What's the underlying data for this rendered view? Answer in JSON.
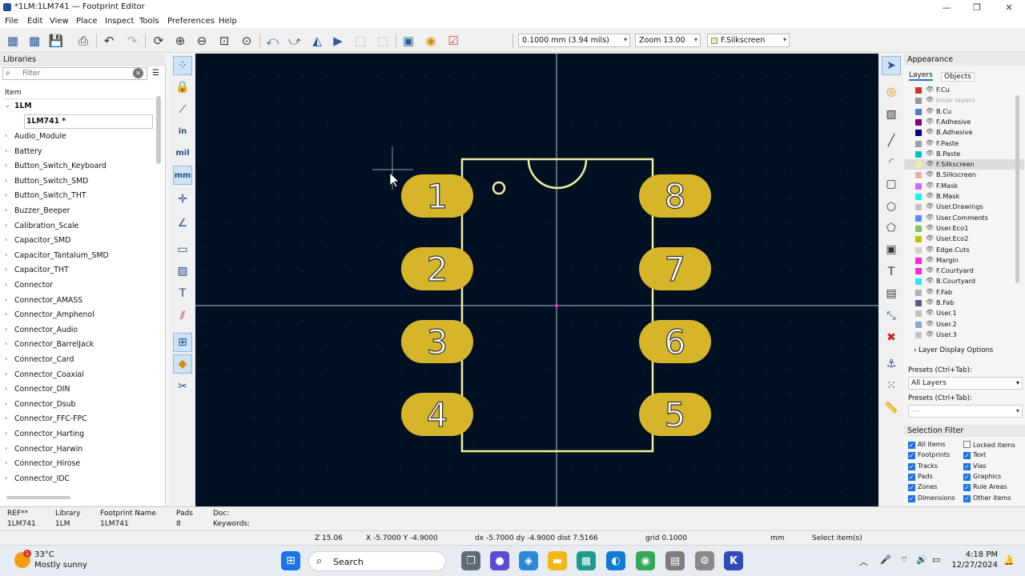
{
  "window": {
    "title": "*1LM:1LM741 — Footprint Editor",
    "minimize": "—",
    "maximize": "❐",
    "close": "✕"
  },
  "menu": [
    "File",
    "Edit",
    "View",
    "Place",
    "Inspect",
    "Tools",
    "Preferences",
    "Help"
  ],
  "toolbar": {
    "grid": "0.1000 mm (3.94 mils)",
    "zoom": "Zoom 13.00",
    "layer": "F.Silkscreen",
    "layer_color": "#f2eda1"
  },
  "libraries": {
    "header": "Libraries",
    "filter_placeholder": "Filter",
    "column_header": "Item",
    "open_library": "1LM",
    "selected_footprint": "1LM741 *",
    "items": [
      "Audio_Module",
      "Battery",
      "Button_Switch_Keyboard",
      "Button_Switch_SMD",
      "Button_Switch_THT",
      "Buzzer_Beeper",
      "Calibration_Scale",
      "Capacitor_SMD",
      "Capacitor_Tantalum_SMD",
      "Capacitor_THT",
      "Connector",
      "Connector_AMASS",
      "Connector_Amphenol",
      "Connector_Audio",
      "Connector_BarrelJack",
      "Connector_Card",
      "Connector_Coaxial",
      "Connector_DIN",
      "Connector_Dsub",
      "Connector_FFC-FPC",
      "Connector_Harting",
      "Connector_Harwin",
      "Connector_Hirose",
      "Connector_IDC"
    ]
  },
  "left_toolbar": {
    "units_in": "in",
    "units_mil": "mil",
    "units_mm": "mm"
  },
  "pads": {
    "left": [
      "1",
      "2",
      "3",
      "4"
    ],
    "right": [
      "8",
      "7",
      "6",
      "5"
    ],
    "pad_color": "#d7b52a",
    "silk_color": "#f2eda1"
  },
  "appearance": {
    "header": "Appearance",
    "tabs": [
      "Layers",
      "Objects"
    ],
    "layers": [
      {
        "name": "F.Cu",
        "color": "#c83434"
      },
      {
        "name": "Inner layers",
        "color": "#999999",
        "dim": true
      },
      {
        "name": "B.Cu",
        "color": "#4d7fc4"
      },
      {
        "name": "F.Adhesive",
        "color": "#84007c"
      },
      {
        "name": "B.Adhesive",
        "color": "#00008a"
      },
      {
        "name": "F.Paste",
        "color": "#a0a0a0"
      },
      {
        "name": "B.Paste",
        "color": "#00c2c2"
      },
      {
        "name": "F.Silkscreen",
        "color": "#f2eda1",
        "active": true
      },
      {
        "name": "B.Silkscreen",
        "color": "#e8b2a7"
      },
      {
        "name": "F.Mask",
        "color": "#d864ff"
      },
      {
        "name": "B.Mask",
        "color": "#02ffee"
      },
      {
        "name": "User.Drawings",
        "color": "#c2c2c2"
      },
      {
        "name": "User.Comments",
        "color": "#598bff"
      },
      {
        "name": "User.Eco1",
        "color": "#85c452"
      },
      {
        "name": "User.Eco2",
        "color": "#c2c200"
      },
      {
        "name": "Edge.Cuts",
        "color": "#d0d2cd"
      },
      {
        "name": "Margin",
        "color": "#ff26e2"
      },
      {
        "name": "F.Courtyard",
        "color": "#ff26e2"
      },
      {
        "name": "B.Courtyard",
        "color": "#26e9ff"
      },
      {
        "name": "F.Fab",
        "color": "#afafaf"
      },
      {
        "name": "B.Fab",
        "color": "#585d84"
      },
      {
        "name": "User.1",
        "color": "#c2c2c2"
      },
      {
        "name": "User.2",
        "color": "#89a9d2"
      },
      {
        "name": "User.3",
        "color": "#c2c2c2"
      }
    ],
    "layer_display_options": "Layer Display Options",
    "presets_label": "Presets (Ctrl+Tab):",
    "presets_value": "All Layers",
    "presets_label2": "Presets (Ctrl+Tab):",
    "presets_value2": "---"
  },
  "selection_filter": {
    "header": "Selection Filter",
    "items": [
      {
        "label": "All items",
        "checked": true
      },
      {
        "label": "Locked items",
        "checked": false
      },
      {
        "label": "Footprints",
        "checked": true
      },
      {
        "label": "Text",
        "checked": true
      },
      {
        "label": "Tracks",
        "checked": true
      },
      {
        "label": "Vias",
        "checked": true
      },
      {
        "label": "Pads",
        "checked": true
      },
      {
        "label": "Graphics",
        "checked": true
      },
      {
        "label": "Zones",
        "checked": true
      },
      {
        "label": "Rule Areas",
        "checked": true
      },
      {
        "label": "Dimensions",
        "checked": true
      },
      {
        "label": "Other items",
        "checked": true
      }
    ]
  },
  "info": {
    "ref_label": "REF**",
    "ref_value": "1LM741",
    "lib_label": "Library",
    "lib_value": "1LM",
    "fp_label": "Footprint Name",
    "fp_value": "1LM741",
    "pads_label": "Pads",
    "pads_value": "8",
    "doc_label": "Doc:",
    "kw_label": "Keywords:"
  },
  "status": {
    "z": "Z 15.06",
    "xy": "X -5.7000  Y -4.9000",
    "delta": "dx -5.7000  dy -4.9000  dist 7.5166",
    "grid": "grid 0.1000",
    "units": "mm",
    "mode": "Select item(s)"
  },
  "taskbar": {
    "weather_temp": "33°C",
    "weather_desc": "Mostly sunny",
    "search": "Search",
    "time": "4:18 PM",
    "date": "12/27/2024"
  }
}
